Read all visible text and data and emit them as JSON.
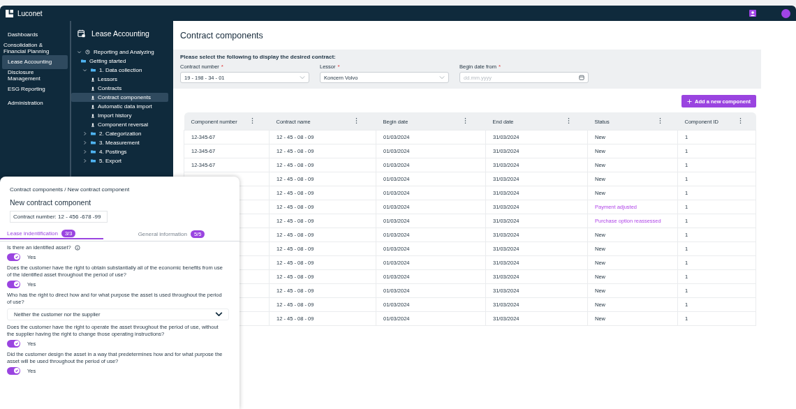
{
  "app": {
    "brand": "Luconet"
  },
  "nav": [
    {
      "label": "Dashboards",
      "selected": false
    },
    {
      "label": "Consolidation & Financial Planning",
      "selected": false
    },
    {
      "label": "Lease Accounting",
      "selected": true
    },
    {
      "label": "Disclosure Management",
      "selected": false
    },
    {
      "label": "ESG Reporting",
      "selected": false
    },
    {
      "label": "Administration",
      "selected": false
    }
  ],
  "module": {
    "title": "Lease Accounting",
    "tree": [
      {
        "label": "Reporting and Analyzing",
        "kind": "clock",
        "expanded": true,
        "selected": false,
        "children": [
          {
            "label": "Getting started",
            "kind": "folder",
            "selected": false
          },
          {
            "label": "1. Data collection",
            "kind": "folder",
            "expanded": true,
            "selected": false,
            "children": [
              {
                "label": "Lessors",
                "kind": "page",
                "selected": false
              },
              {
                "label": "Contracts",
                "kind": "page",
                "selected": false
              },
              {
                "label": "Contract components",
                "kind": "page",
                "selected": true
              },
              {
                "label": "Automatic data import",
                "kind": "page",
                "selected": false
              },
              {
                "label": "Import history",
                "kind": "page",
                "selected": false
              },
              {
                "label": "Component reversal",
                "kind": "page",
                "selected": false
              }
            ]
          },
          {
            "label": "2. Categorization",
            "kind": "folder",
            "expanded": false,
            "selected": false
          },
          {
            "label": "3. Measurement",
            "kind": "folder",
            "expanded": false,
            "selected": false
          },
          {
            "label": "4. Postings",
            "kind": "folder",
            "expanded": false,
            "selected": false
          },
          {
            "label": "5. Export",
            "kind": "folder",
            "expanded": false,
            "selected": false
          }
        ]
      }
    ]
  },
  "page": {
    "title": "Contract components",
    "filter_heading": "Please select the following to display the desired contract:",
    "filters": [
      {
        "label": "Contract number",
        "required_mark": "*",
        "kind": "select",
        "value": "19 - 198 - 34 - 01"
      },
      {
        "label": "Lessor",
        "required_mark": "*",
        "kind": "select",
        "value": "Koncern Volvo"
      },
      {
        "label": "Begin date from",
        "required_mark": "*",
        "kind": "date",
        "placeholder": "dd.mm.yyyy"
      }
    ],
    "add_button": "Add a new component"
  },
  "table": {
    "columns": [
      "Component number",
      "Contract name",
      "Begin date",
      "End date",
      "Status",
      "Component ID"
    ],
    "rows": [
      {
        "component_number": "12-345-67",
        "contract_name": "12 - 45 - 08 - 09",
        "begin_date": "01/03/2024",
        "end_date": "31/03/2024",
        "status": "New",
        "highlighted": false,
        "component_id": "1"
      },
      {
        "component_number": "12-345-67",
        "contract_name": "12 - 45 - 08 - 09",
        "begin_date": "01/03/2024",
        "end_date": "31/03/2024",
        "status": "New",
        "highlighted": false,
        "component_id": "1"
      },
      {
        "component_number": "12-345-67",
        "contract_name": "12 - 45 - 08 - 09",
        "begin_date": "01/03/2024",
        "end_date": "31/03/2024",
        "status": "New",
        "highlighted": false,
        "component_id": "1"
      },
      {
        "contract_name": "12 - 45 - 08 - 09",
        "begin_date": "01/03/2024",
        "end_date": "31/03/2024",
        "status": "New",
        "highlighted": false,
        "component_id": "1"
      },
      {
        "contract_name": "12 - 45 - 08 - 09",
        "begin_date": "01/03/2024",
        "end_date": "31/03/2024",
        "status": "New",
        "highlighted": false,
        "component_id": "1"
      },
      {
        "contract_name": "12 - 45 - 08 - 09",
        "begin_date": "01/03/2024",
        "end_date": "31/03/2024",
        "status": "Payment adjusted",
        "highlighted": true,
        "component_id": "1"
      },
      {
        "contract_name": "12 - 45 - 08 - 09",
        "begin_date": "01/03/2024",
        "end_date": "31/03/2024",
        "status": "Purchase option reassessed",
        "highlighted": true,
        "component_id": "1"
      },
      {
        "contract_name": "12 - 45 - 08 - 09",
        "begin_date": "01/03/2024",
        "end_date": "31/03/2024",
        "status": "New",
        "highlighted": false,
        "component_id": "1"
      },
      {
        "contract_name": "12 - 45 - 08 - 09",
        "begin_date": "01/03/2024",
        "end_date": "31/03/2024",
        "status": "New",
        "highlighted": false,
        "component_id": "1"
      },
      {
        "contract_name": "12 - 45 - 08 - 09",
        "begin_date": "01/03/2024",
        "end_date": "31/03/2024",
        "status": "New",
        "highlighted": false,
        "component_id": "1"
      },
      {
        "contract_name": "12 - 45 - 08 - 09",
        "begin_date": "01/03/2024",
        "end_date": "31/03/2024",
        "status": "New",
        "highlighted": false,
        "component_id": "1"
      },
      {
        "contract_name": "12 - 45 - 08 - 09",
        "begin_date": "01/03/2024",
        "end_date": "31/03/2024",
        "status": "New",
        "highlighted": false,
        "component_id": "1"
      },
      {
        "contract_name": "12 - 45 - 08 - 09",
        "begin_date": "01/03/2024",
        "end_date": "31/03/2024",
        "status": "New",
        "highlighted": false,
        "component_id": "1"
      },
      {
        "contract_name": "12 - 45 - 08 - 09",
        "begin_date": "01/03/2024",
        "end_date": "31/03/2024",
        "status": "New",
        "highlighted": false,
        "component_id": "1"
      }
    ]
  },
  "panel": {
    "breadcrumb": "Contract components / New contract  component",
    "title": "New contract component",
    "contract_number": "Contract number: 12 - 456 -678 -99",
    "tabs": [
      {
        "label": "Lease indentification",
        "badge": "3/3",
        "selected": true
      },
      {
        "label": "General information",
        "badge": "5/5",
        "selected": false
      }
    ],
    "questions": [
      {
        "kind": "toggle",
        "text": "Is there an identified asset?",
        "info": true,
        "on": true,
        "answer": "Yes"
      },
      {
        "kind": "toggle",
        "text": "Does the customer have the right to obtain substantially all of the economic benefits from use of the identified asset throughout the period of use?",
        "info": false,
        "on": true,
        "answer": "Yes"
      },
      {
        "kind": "select",
        "text": "Who has the right to direct how and for what purpose the asset is used throughout the period of use?",
        "info": false,
        "answer": "Neither the customer nor the supplier"
      },
      {
        "kind": "toggle",
        "text": "Does the customer have the right to operate the asset throughout the period of use, without the supplier having the right to change those operating instructions?",
        "info": false,
        "on": true,
        "answer": "Yes"
      },
      {
        "kind": "toggle",
        "text": "Did the customer design the asset in a way that predetermines how and for what purpose the asset will be used throughout the period of use?",
        "info": false,
        "on": true,
        "answer": "Yes"
      }
    ]
  }
}
